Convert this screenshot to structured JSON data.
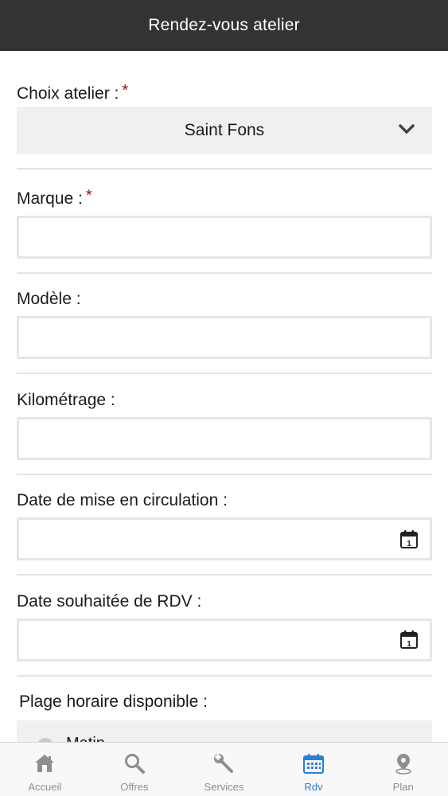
{
  "header": {
    "title": "Rendez-vous atelier"
  },
  "form": {
    "workshop": {
      "label": "Choix atelier :",
      "required_mark": "*",
      "selected": "Saint Fons"
    },
    "brand": {
      "label": "Marque :",
      "required_mark": "*",
      "value": "",
      "placeholder": ""
    },
    "model": {
      "label": "Modèle :",
      "value": "",
      "placeholder": ""
    },
    "mileage": {
      "label": "Kilométrage :",
      "value": "",
      "placeholder": ""
    },
    "registration_date": {
      "label": "Date de mise en circulation :",
      "value": "",
      "calendar_icon_number": "1"
    },
    "appointment_date": {
      "label": "Date souhaitée de RDV :",
      "value": "",
      "calendar_icon_number": "1"
    },
    "time_slot": {
      "label": "Plage horaire disponible :",
      "first_option": "Matin"
    }
  },
  "tabbar": {
    "active": "Rdv",
    "active_color": "#2a7fd6",
    "inactive_color": "#8e8e93",
    "items": [
      {
        "label": "Accueil",
        "icon": "home-icon"
      },
      {
        "label": "Offres",
        "icon": "search-icon"
      },
      {
        "label": "Services",
        "icon": "wrench-icon"
      },
      {
        "label": "Rdv",
        "icon": "calendar-icon"
      },
      {
        "label": "Plan",
        "icon": "map-pin-icon"
      }
    ]
  }
}
